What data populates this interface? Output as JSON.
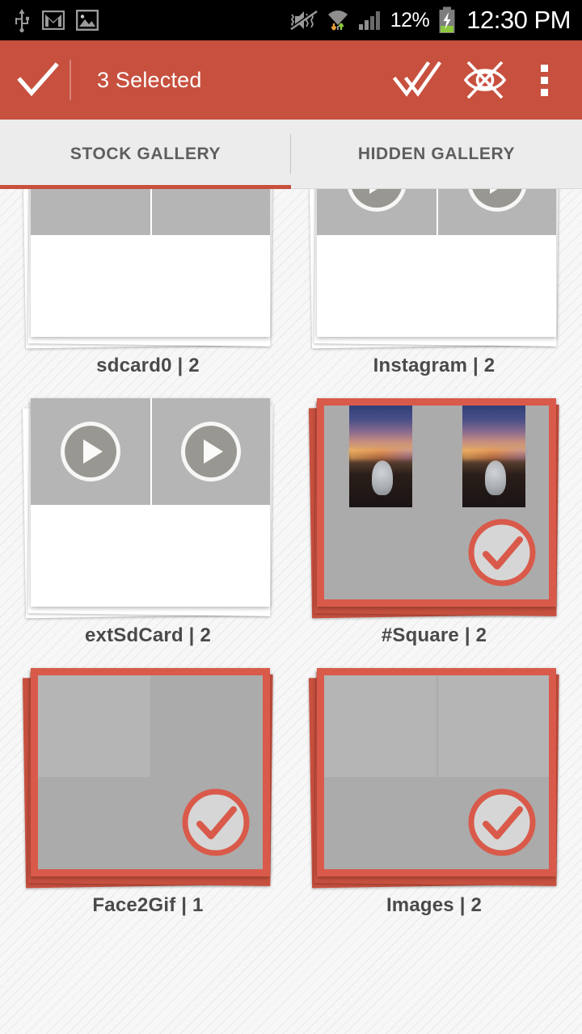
{
  "status_bar": {
    "time": "12:30 PM",
    "battery_percent": "12%",
    "icons": [
      "usb-icon",
      "gmail-icon",
      "image-icon",
      "vibrate-off-icon",
      "wifi-icon",
      "signal-icon",
      "battery-charging-icon"
    ]
  },
  "action_bar": {
    "home_icon": "check-icon",
    "title": "3 Selected",
    "selected_count": 3,
    "accent_color": "#c7503f",
    "actions": [
      {
        "name": "select-all-button",
        "icon": "double-check-icon"
      },
      {
        "name": "hide-button",
        "icon": "eye-crossed-icon"
      },
      {
        "name": "overflow-menu-button",
        "icon": "more-vertical-icon"
      }
    ]
  },
  "tabs": [
    {
      "label": "STOCK GALLERY",
      "active": true
    },
    {
      "label": "HIDDEN GALLERY",
      "active": false
    }
  ],
  "gallery": {
    "rows": [
      [
        {
          "name": "sdcard0",
          "count": 2,
          "label": "sdcard0 | 2",
          "selected": false,
          "thumbs": [
            {
              "style": "ph-city",
              "video": false
            },
            {
              "style": "ph-mountain-bw",
              "video": false
            }
          ]
        },
        {
          "name": "Instagram",
          "count": 2,
          "label": "Instagram | 2",
          "selected": false,
          "thumbs": [
            {
              "style": "ph-wood",
              "video": true
            },
            {
              "style": "ph-selfie",
              "video": true
            }
          ]
        }
      ],
      [
        {
          "name": "extSdCard",
          "count": 2,
          "label": "extSdCard | 2",
          "selected": false,
          "thumbs": [
            {
              "style": "ph-dark-pet",
              "video": true
            },
            {
              "style": "ph-floor",
              "video": true
            }
          ]
        },
        {
          "name": "#Square",
          "count": 2,
          "label": "#Square | 2",
          "selected": true,
          "square": true,
          "thumbs": [
            {
              "style": "ph-sunset-sq",
              "video": false
            },
            {
              "style": "ph-sunset-sq",
              "video": false
            }
          ]
        }
      ],
      [
        {
          "name": "Face2Gif",
          "count": 1,
          "label": "Face2Gif | 1",
          "selected": true,
          "thumbs": [
            {
              "style": "ph-face",
              "video": false
            },
            {
              "style": "empty",
              "video": false
            }
          ]
        },
        {
          "name": "Images",
          "count": 2,
          "label": "Images | 2",
          "selected": true,
          "thumbs": [
            {
              "style": "ph-city-purple",
              "video": false
            },
            {
              "style": "ph-mountain-bw2",
              "video": false
            }
          ]
        }
      ]
    ]
  }
}
